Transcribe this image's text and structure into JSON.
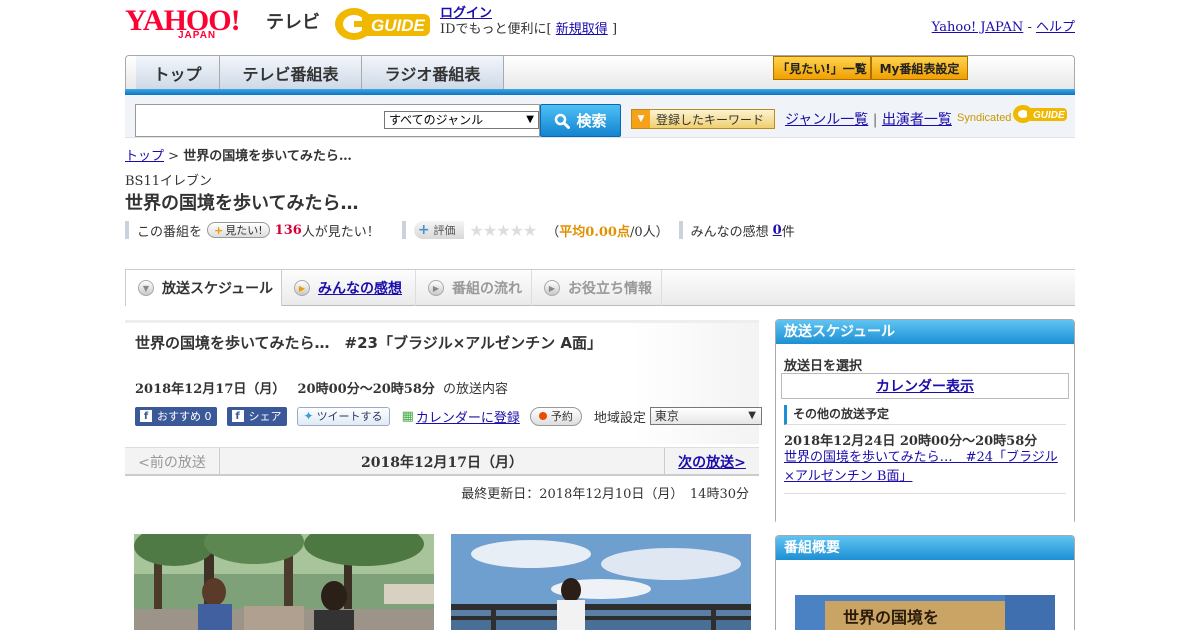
{
  "header": {
    "logo_yahoo": "YAHOO!",
    "logo_japan": "JAPAN",
    "logo_tv": "テレビ",
    "logo_gguide": "GUIDE",
    "login_label": "ログイン",
    "login_prefix": "IDでもっと便利に[",
    "signup_label": "新規取得",
    "login_suffix": "]",
    "yahoo_japan_link": "Yahoo! JAPAN",
    "separator": "-",
    "help_link": "ヘルプ"
  },
  "nav": {
    "tabs": [
      "トップ",
      "テレビ番組表",
      "ラジオ番組表"
    ],
    "mitai_list": "「見たい!」一覧",
    "my_schedule": "My番組表設定"
  },
  "search": {
    "genre_selected": "すべてのジャンル",
    "search_button": "検索",
    "keyword_button": "登録したキーワード",
    "genre_list": "ジャンル一覧",
    "divider": "|",
    "performers": "出演者一覧",
    "syndicated": "Syndicated"
  },
  "breadcrumb": {
    "top": "トップ",
    "sep": ">",
    "current": "世界の国境を歩いてみたら…"
  },
  "program": {
    "station": "BS11イレブン",
    "title": "世界の国境を歩いてみたら…",
    "stats": {
      "prefix": "この番組を",
      "mitai_button": "見たい!",
      "mitai_count": "136",
      "mitai_suffix": "人が見たい！",
      "eval_button": "評価",
      "stars": "★★★★★",
      "avg_open": "（",
      "avg_label": "平均0.00点",
      "avg_count": "/0人",
      "avg_close": "）",
      "review_label": "みんなの感想",
      "review_count": "0",
      "review_suffix": "件"
    }
  },
  "tabs": [
    {
      "label": "放送スケジュール"
    },
    {
      "label": "みんなの感想"
    },
    {
      "label": "番組の流れ"
    },
    {
      "label": "お役立ち情報"
    }
  ],
  "episode": {
    "title": "世界の国境を歩いてみたら…　#23「ブラジル×アルゼンチン A面」",
    "date": "2018年12月17日（月）",
    "time": "20時00分～20時58分",
    "time_suffix": "の放送内容",
    "fb_recommend": "おすすめ 0",
    "fb_share": "シェア",
    "tweet": "ツイートする",
    "calendar": "カレンダーに登録",
    "reserve": "予約",
    "region_label": "地域設定",
    "region_value": "東京"
  },
  "pager": {
    "prev": "<前の放送",
    "current": "2018年12月17日（月）",
    "next": "次の放送>"
  },
  "updated": "最終更新日：2018年12月10日（月）　14時30分",
  "sidebar": {
    "schedule_title": "放送スケジュール",
    "select_date": "放送日を選択",
    "calendar": "カレンダー表示",
    "other_title": "その他の放送予定",
    "next_time": "2018年12月24日  20時00分～20時58分",
    "next_title": "世界の国境を歩いてみたら…　#24「ブラジル×アルゼンチン B面」",
    "overview_title": "番組概要",
    "thumb_text": "世界の国境を"
  },
  "colors": {
    "brand_red": "#ff0033",
    "accent_blue": "#1d8fd4",
    "link": "#1a0dab",
    "count_red": "#d70035",
    "avg_orange": "#e09000"
  }
}
